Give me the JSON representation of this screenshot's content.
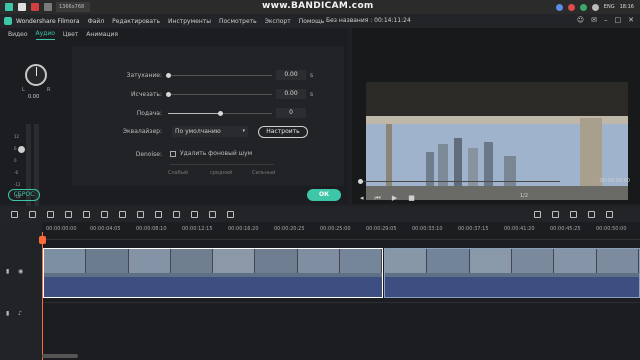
{
  "taskbar": {
    "tab_label": "1366x768",
    "watermark": "www.BANDICAM.com",
    "tray": {
      "lang": "ENG",
      "time": "18:16"
    }
  },
  "app": {
    "name": "Wondershare Filmora",
    "menu": [
      "Файл",
      "Редактировать",
      "Инструменты",
      "Посмотреть",
      "Экспорт",
      "Помощь"
    ],
    "project_title": "Без названия : 00:14:11:24"
  },
  "tabs": [
    {
      "label": "Видео",
      "active": false
    },
    {
      "label": "Аудио",
      "active": true
    },
    {
      "label": "Цвет",
      "active": false
    },
    {
      "label": "Анимация",
      "active": false
    }
  ],
  "volume": {
    "L": "L",
    "R": "R",
    "value": "0.00",
    "db_scale": [
      "12",
      "6",
      "0",
      "-6",
      "-12",
      "-18",
      "-24",
      "-30"
    ]
  },
  "settings": {
    "fade_in_label": "Затухание:",
    "fade_in_value": "0.00",
    "fade_in_unit": "s",
    "fade_out_label": "Исчезать:",
    "fade_out_value": "0.00",
    "fade_out_unit": "s",
    "pitch_label": "Подача:",
    "pitch_value": "0",
    "pitch_level": 0.5,
    "equalizer_label": "Эквалайзер:",
    "equalizer_value": "По умолчанию",
    "equalizer_button": "Настроить",
    "denoise_label": "Denoise:",
    "denoise_check_label": "Удалить фоновый шум",
    "denoise_levels": [
      "Слабый",
      "средний",
      "Сильный"
    ]
  },
  "buttons": {
    "reset": "СБРОС",
    "ok": "ОК"
  },
  "preview": {
    "timecode": "00:00:00:00",
    "page": "1/2",
    "progress": 0.0
  },
  "timeline": {
    "ticks": [
      "00:00:00:00",
      "00:00:04:05",
      "00:00:08:10",
      "00:00:12:15",
      "00:00:16:20",
      "00:00:20:25",
      "00:00:25:00",
      "00:00:29:05",
      "00:00:33:10",
      "00:00:37:15",
      "00:00:41:20",
      "00:00:45:25",
      "00:00:50:00"
    ]
  },
  "colors": {
    "accent": "#3ec6a8",
    "playhead": "#ff6a3c"
  }
}
